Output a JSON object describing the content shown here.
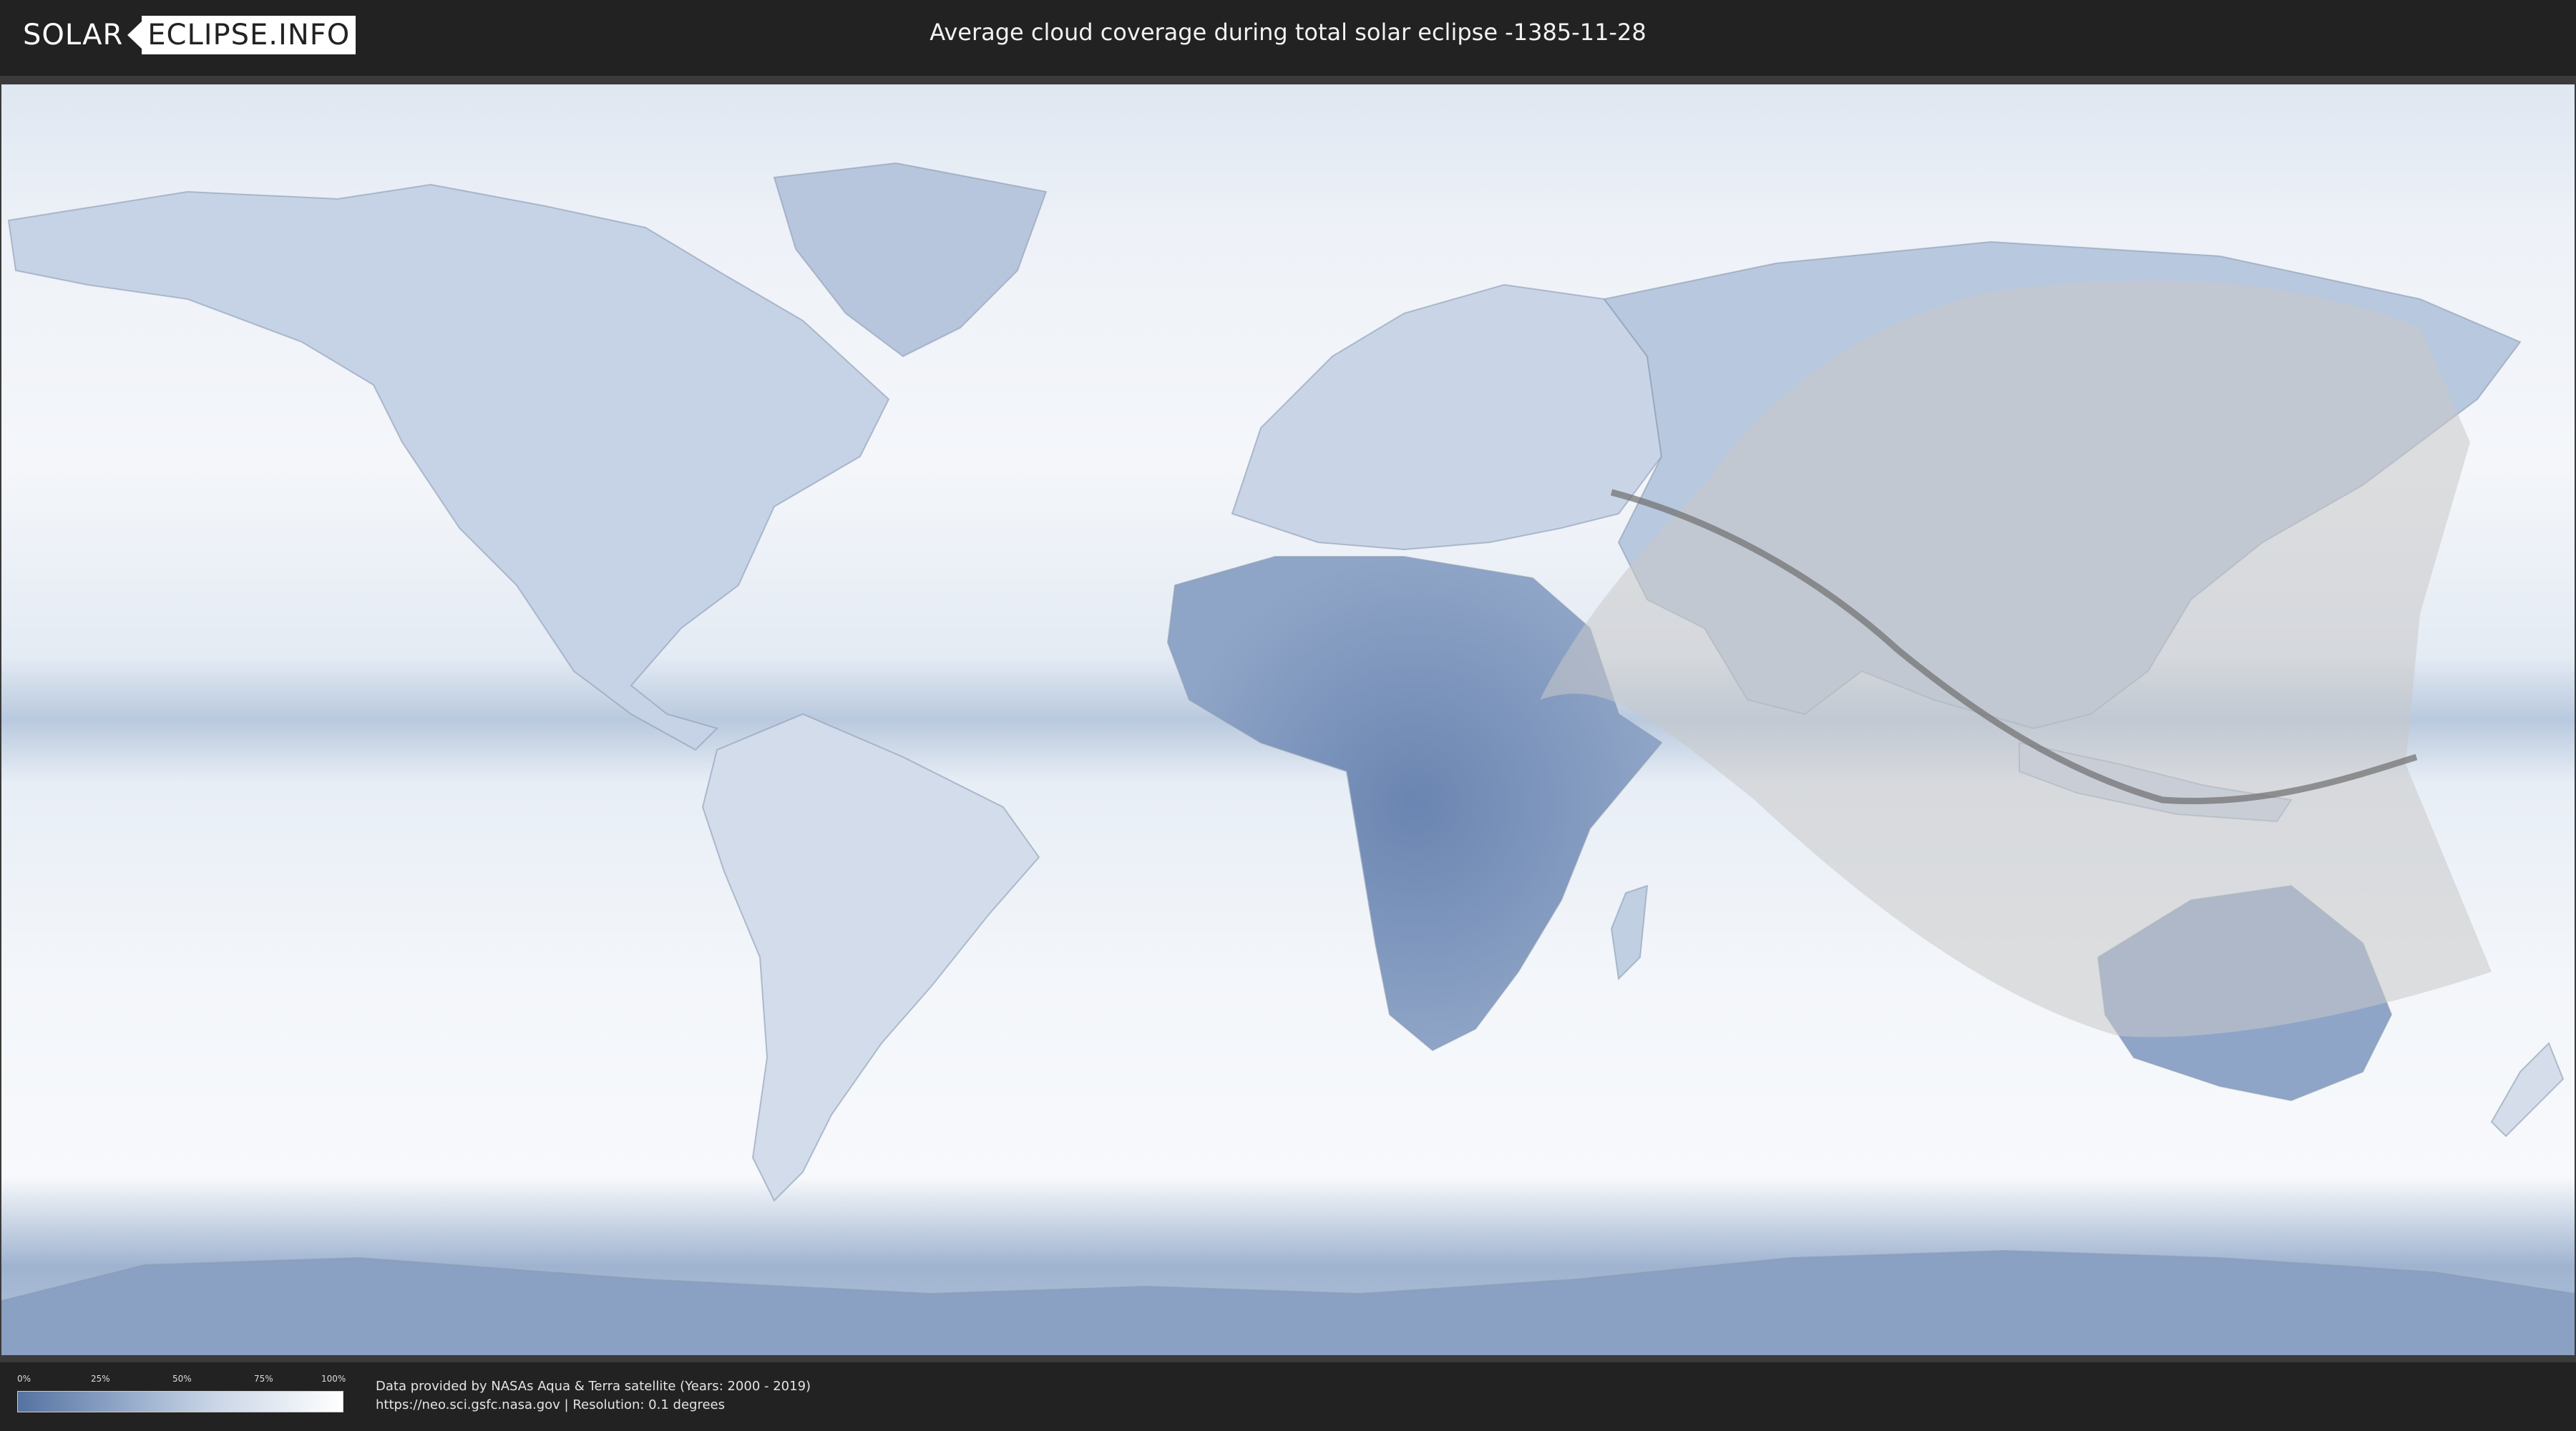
{
  "header": {
    "logo_left": "SOLAR",
    "logo_right": "ECLIPSE.INFO",
    "title": "Average cloud coverage during total solar eclipse -1385-11-28"
  },
  "legend": {
    "ticks": [
      "0%",
      "25%",
      "50%",
      "75%",
      "100%"
    ],
    "gradient_colors": [
      "#5572a0",
      "#ffffff"
    ]
  },
  "footer": {
    "credit_line": "Data provided by NASAs Aqua & Terra satellite (Years: 2000 - 2019)",
    "source_line": "https://neo.sci.gsfc.nasa.gov | Resolution: 0.1 degrees"
  },
  "colors": {
    "background": "#222222",
    "cloud_clear": "#5572a0",
    "cloud_full": "#ffffff",
    "eclipse_shadow": "#cfcfcf",
    "central_line": "#6d6d6d"
  }
}
